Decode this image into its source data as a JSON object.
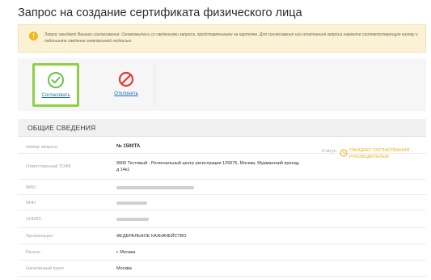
{
  "page": {
    "title": "Запрос на создание сертификата физического лица"
  },
  "notice": {
    "icon": "warning-icon",
    "text": "Запрос ожидает Вашего согласования. Ознакомьтесь со сведениями запроса, представленными на карточке. Для согласования или отклонения запроса нажмите соответствующую кнопку и подпишите сведения электронной подписью."
  },
  "actions": {
    "approve": {
      "label": "Согласовать",
      "icon": "check-circle-icon",
      "color": "#6cc04a"
    },
    "reject": {
      "label": "Отклонить",
      "icon": "forbidden-icon",
      "color": "#e53935"
    }
  },
  "section": {
    "title": "ОБЩИЕ СВЕДЕНИЯ"
  },
  "status": {
    "label": "Статус:",
    "value": "ОЖИДАЕТ СОГЛАСОВАНИЯ РУКОВОДИТЕЛЕМ",
    "icon": "clock-icon",
    "color": "#e7b21c"
  },
  "fields": {
    "request_number": {
      "label": "Номер запроса",
      "value": "№ 1500TA"
    },
    "tofk": {
      "label": "Ответственный ТОФК",
      "value": "9900 Тестовый - Региональный центр регистрации 129075, Москва, Мурманский проезд, д 14к1"
    },
    "fio": {
      "label": "ФИО"
    },
    "inn": {
      "label": "ИНН"
    },
    "snils": {
      "label": "СНИЛС"
    },
    "organization": {
      "label": "Организация",
      "value": "ФЕДЕРАЛЬНОЕ КАЗНАЧЕЙСТВО"
    },
    "region": {
      "label": "Регион",
      "value": "г. Москва"
    },
    "locality": {
      "label": "Населенный пункт",
      "value": "Москва"
    }
  }
}
